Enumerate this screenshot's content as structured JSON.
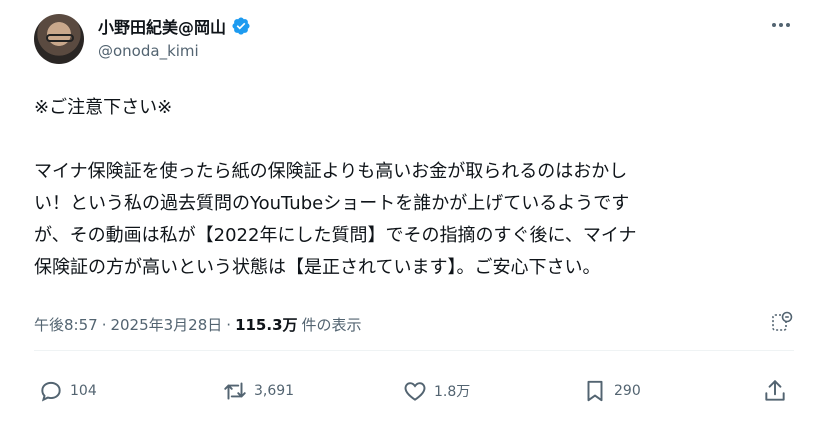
{
  "author": {
    "display_name": "小野田紀美@岡山",
    "handle": "@onoda_kimi",
    "verified": true
  },
  "tweet": {
    "lines": [
      "※ご注意下さい※",
      "",
      "マイナ保険証を使ったら紙の保険証よりも高いお金が取られるのはおかし",
      "い！という私の過去質問のYouTubeショートを誰かが上げているようです",
      "が、その動画は私が【2022年にした質問】でその指摘のすぐ後に、マイナ",
      "保険証の方が高いという状態は【是正されています】。ご安心下さい。"
    ]
  },
  "meta": {
    "time": "午後8:57",
    "separator1": "·",
    "date": "2025年3月28日",
    "separator2": "·",
    "views": "115.3万",
    "views_label": "件の表示"
  },
  "actions": {
    "replies": "104",
    "reposts": "3,691",
    "likes": "1.8万",
    "bookmarks": "290"
  },
  "colors": {
    "verified": "#1d9bf0",
    "text": "#0f1419",
    "muted": "#536471"
  }
}
